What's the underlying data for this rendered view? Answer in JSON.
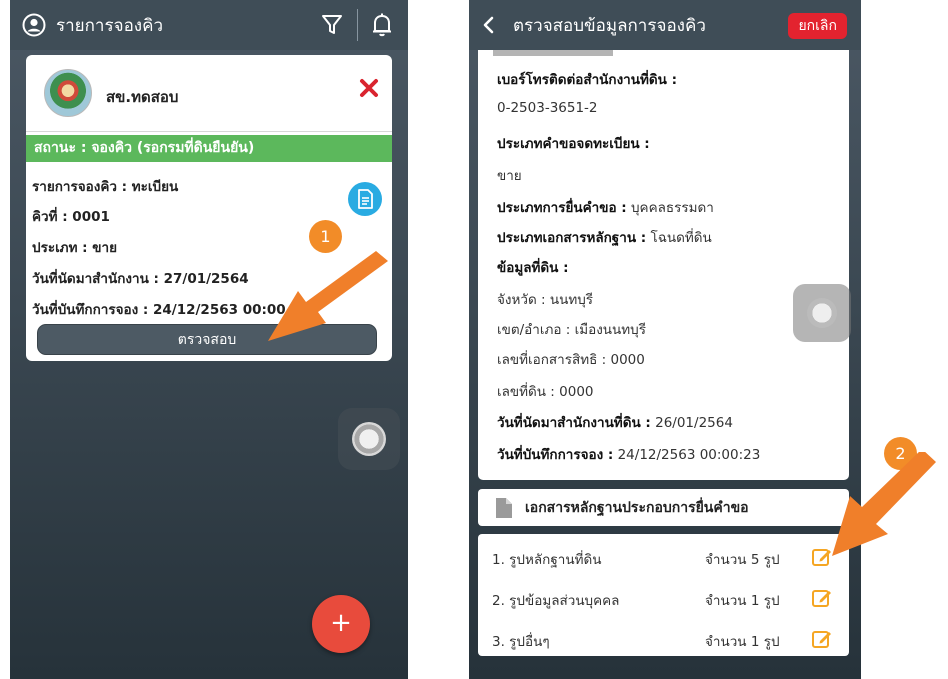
{
  "screen1": {
    "title": "รายการจองคิว",
    "card": {
      "office_name": "สข.ทดสอบ",
      "status": "สถานะ : จองคิว (รอกรมที่ดินยืนยัน)",
      "lines": [
        "รายการจองคิว : ทะเบียน",
        "คิวที่ : 0001",
        "ประเภท : ขาย",
        "วันที่นัดมาสำนักงาน : 27/01/2564",
        "วันที่บันทึกการจอง : 24/12/2563 00:00"
      ],
      "check_button": "ตรวจสอบ"
    },
    "add_button": "+"
  },
  "screen2": {
    "title": "ตรวจสอบข้อมูลการจองคิว",
    "cancel_button": "ยกเลิก",
    "details": {
      "phone_label": "เบอร์โทรติดต่อสำนักงานที่ดิน :",
      "phone_value": "0-2503-3651-2",
      "request_type_label": "ประเภทคำขอจดทะเบียน :",
      "request_type_value": "ขาย",
      "submit_type_label": "ประเภทการยื่นคำขอ :",
      "submit_type_value": "บุคคลธรรมดา",
      "doc_type_label": "ประเภทเอกสารหลักฐาน :",
      "doc_type_value": "โฉนดที่ดิน",
      "land_info_label": "ข้อมูลที่ดิน :",
      "province": "จังหวัด : นนทบุรี",
      "district": "เขต/อำเภอ : เมืองนนทบุรี",
      "deed_no": "เลขที่เอกสารสิทธิ : 0000",
      "land_no": "เลขที่ดิน : 0000",
      "appointment_label": "วันที่นัดมาสำนักงานที่ดิน :",
      "appointment_value": "26/01/2564",
      "record_label": "วันที่บันทึกการจอง :",
      "record_value": "24/12/2563 00:00:23"
    },
    "documents_title": "เอกสารหลักฐานประกอบการยื่นคำขอ",
    "documents": [
      {
        "label": "1. รูปหลักฐานที่ดิน",
        "count": "จำนวน 5 รูป"
      },
      {
        "label": "2. รูปข้อมูลส่วนบุคคล",
        "count": "จำนวน 1 รูป"
      },
      {
        "label": "3. รูปอื่นๆ",
        "count": "จำนวน 1 รูป"
      }
    ]
  },
  "annotations": {
    "step1": "1",
    "step2": "2",
    "arrow_color": "#f07f2a"
  },
  "colors": {
    "status_green": "#5cb85c",
    "cancel_red": "#e3232f",
    "fab_red": "#e84b3c",
    "doc_blue": "#29abe2",
    "edit_orange": "#f5a623"
  }
}
